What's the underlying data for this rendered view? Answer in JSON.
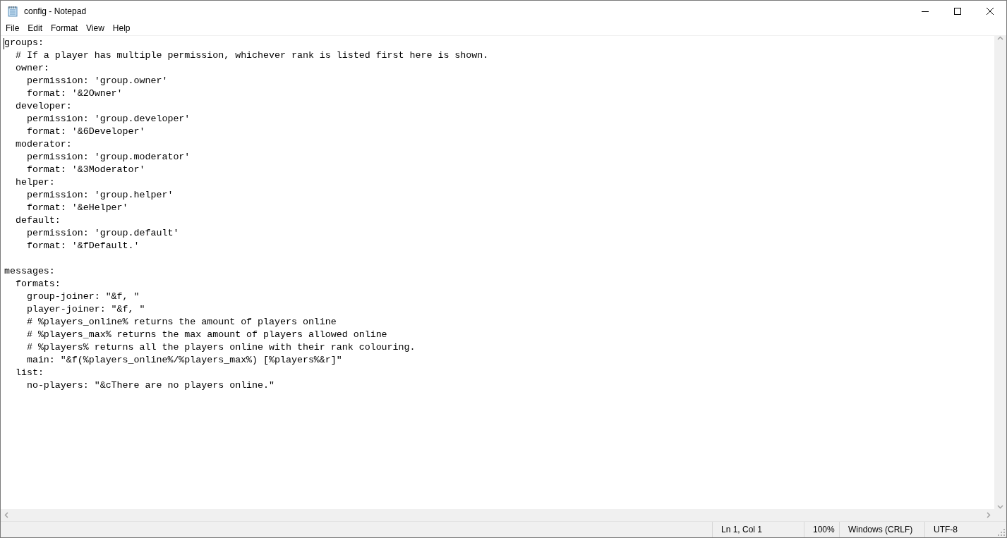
{
  "window": {
    "title": "config - Notepad"
  },
  "menu": [
    "File",
    "Edit",
    "Format",
    "View",
    "Help"
  ],
  "editor": {
    "blocks": [
      [
        "groups:",
        "  # If a player has multiple permission, whichever rank is listed first here is shown.",
        "  owner:",
        "    permission: 'group.owner'",
        "    format: '&2Owner'",
        "  developer:",
        "    permission: 'group.developer'",
        "    format: '&6Developer'",
        "  moderator:",
        "    permission: 'group.moderator'",
        "    format: '&3Moderator'",
        "  helper:",
        "    permission: 'group.helper'",
        "    format: '&eHelper'",
        "  default:",
        "    permission: 'group.default'",
        "    format: '&fDefault.'"
      ],
      [
        "messages:",
        "  formats:",
        "    group-joiner: \"&f, \"",
        "    player-joiner: \"&f, \"",
        "    # %players_online% returns the amount of players online",
        "    # %players_max% returns the max amount of players allowed online",
        "    # %players% returns all the players online with their rank colouring.",
        "    main: \"&f(%players_online%/%players_max%) [%players%&r]\"",
        "  list:",
        "    no-players: \"&cThere are no players online.\""
      ]
    ]
  },
  "status_bar": {
    "position": "Ln 1, Col 1",
    "zoom": "100%",
    "line_ending": "Windows (CRLF)",
    "encoding": "UTF-8"
  }
}
